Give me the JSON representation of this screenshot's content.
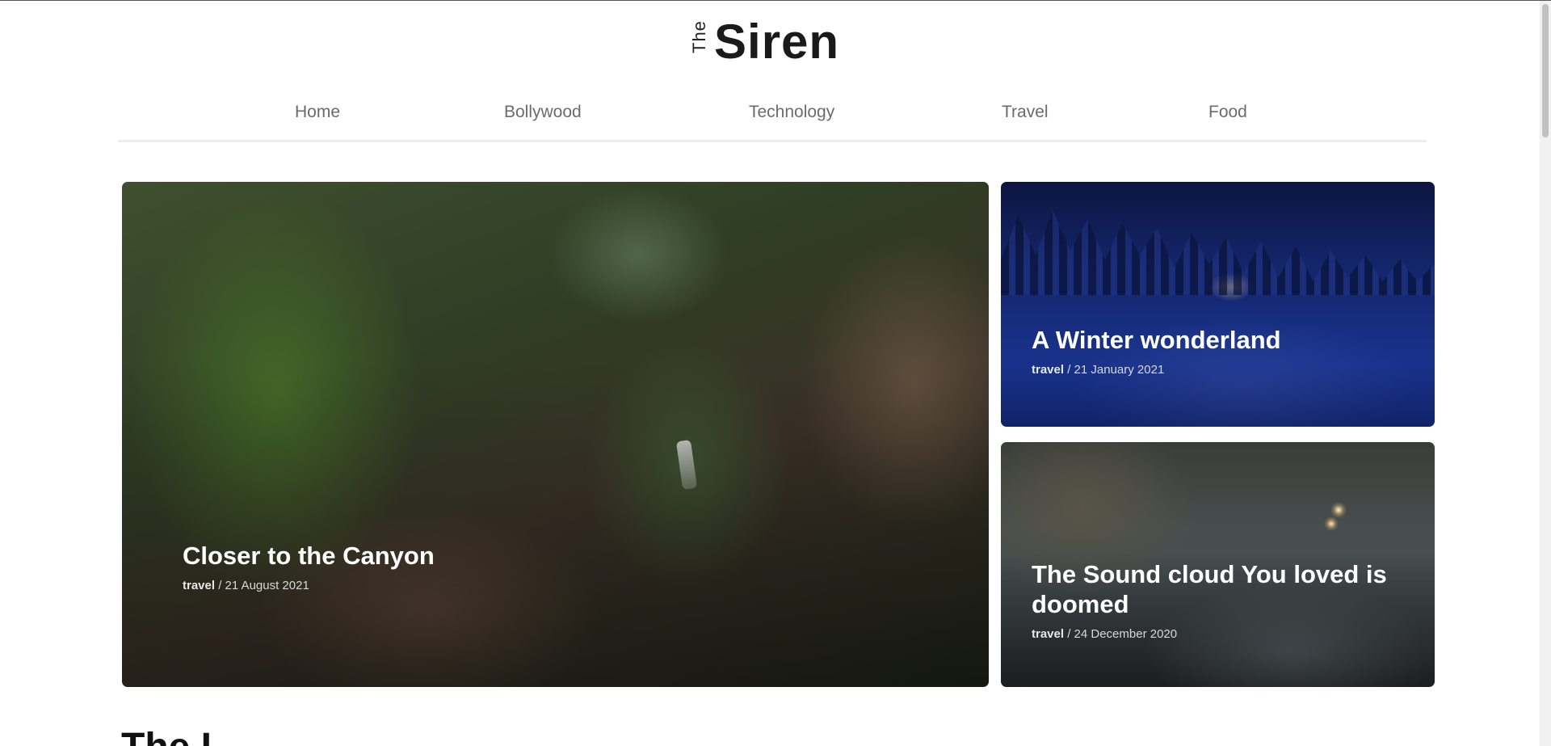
{
  "logo": {
    "prefix": "The",
    "name": "Siren"
  },
  "nav": {
    "items": [
      {
        "label": "Home"
      },
      {
        "label": "Bollywood"
      },
      {
        "label": "Technology"
      },
      {
        "label": "Travel"
      },
      {
        "label": "Food"
      }
    ]
  },
  "featured": [
    {
      "title": "Closer to the Canyon",
      "category": "travel",
      "date": " / 21 August 2021",
      "image": "canyon-cliffs-photo"
    },
    {
      "title": "A Winter wonderland",
      "category": "travel",
      "date": " / 21 January 2021",
      "image": "snowy-forest-cabin-photo"
    },
    {
      "title": "The Sound cloud You loved is doomed",
      "category": "travel",
      "date": " / 24 December 2020",
      "image": "alien-landscape-two-suns-photo"
    }
  ],
  "section": {
    "heading": "The L"
  }
}
